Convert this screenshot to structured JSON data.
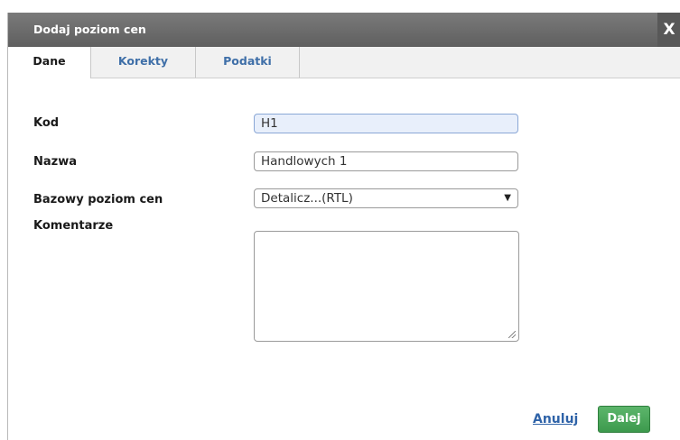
{
  "dialog": {
    "title": "Dodaj poziom cen",
    "close_label": "X"
  },
  "tabs": [
    {
      "label": "Dane",
      "active": true
    },
    {
      "label": "Korekty",
      "active": false
    },
    {
      "label": "Podatki",
      "active": false
    }
  ],
  "form": {
    "kod": {
      "label": "Kod",
      "value": "H1"
    },
    "nazwa": {
      "label": "Nazwa",
      "value": "Handlowych 1"
    },
    "bazowy": {
      "label": "Bazowy poziom cen",
      "value": "Detalicz...(RTL)"
    },
    "komentarze": {
      "label": "Komentarze",
      "value": ""
    }
  },
  "footer": {
    "cancel_label": "Anuluj",
    "next_label": "Dalej"
  },
  "colors": {
    "titlebar": "#6e6e6e",
    "link": "#2f63a8",
    "next_button": "#4aa65a",
    "focused_field": "#e8effb"
  },
  "icons": {
    "close": "x-icon",
    "select": "chevron-down-icon",
    "resize": "resize-grip-icon"
  }
}
